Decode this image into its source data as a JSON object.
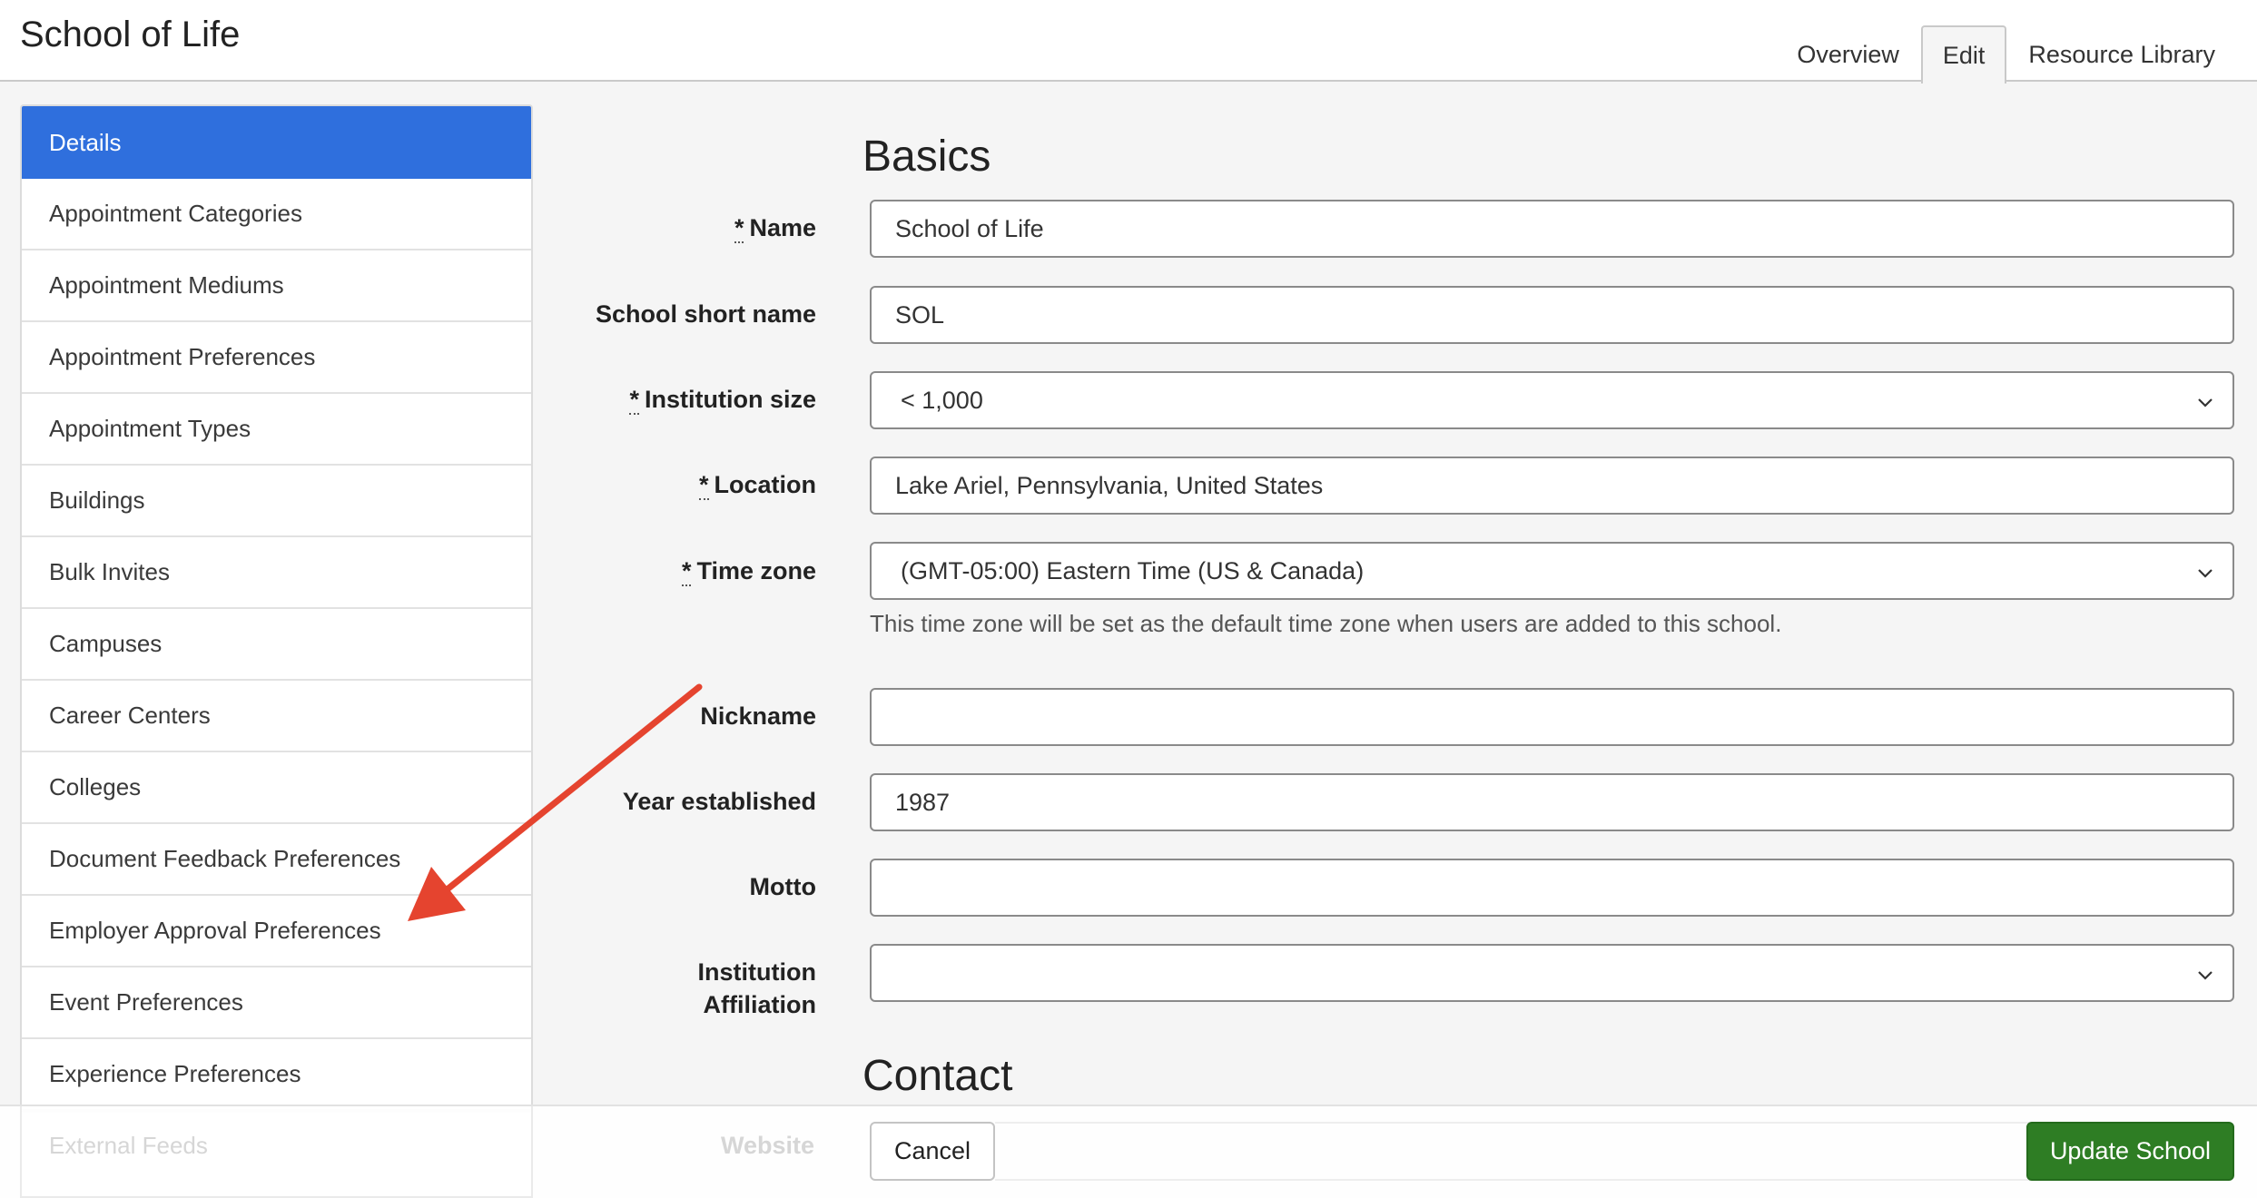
{
  "header": {
    "title": "School of Life",
    "tabs": [
      {
        "label": "Overview"
      },
      {
        "label": "Edit"
      },
      {
        "label": "Resource Library"
      }
    ]
  },
  "sidebar": {
    "items": [
      {
        "label": "Details"
      },
      {
        "label": "Appointment Categories"
      },
      {
        "label": "Appointment Mediums"
      },
      {
        "label": "Appointment Preferences"
      },
      {
        "label": "Appointment Types"
      },
      {
        "label": "Buildings"
      },
      {
        "label": "Bulk Invites"
      },
      {
        "label": "Campuses"
      },
      {
        "label": "Career Centers"
      },
      {
        "label": "Colleges"
      },
      {
        "label": "Document Feedback Preferences"
      },
      {
        "label": "Employer Approval Preferences"
      },
      {
        "label": "Event Preferences"
      },
      {
        "label": "Experience Preferences"
      },
      {
        "label": "External Feeds"
      }
    ]
  },
  "basics": {
    "title": "Basics",
    "name": {
      "label": "Name",
      "required": "*",
      "value": "School of Life"
    },
    "short_name": {
      "label": "School short name",
      "value": "SOL"
    },
    "institution_size": {
      "label": "Institution size",
      "required": "*",
      "value": "< 1,000"
    },
    "location": {
      "label": "Location",
      "required": "*",
      "value": "Lake Ariel, Pennsylvania, United States"
    },
    "time_zone": {
      "label": "Time zone",
      "required": "*",
      "value": "(GMT-05:00) Eastern Time (US & Canada)",
      "hint": "This time zone will be set as the default time zone when users are added to this school."
    },
    "nickname": {
      "label": "Nickname",
      "value": ""
    },
    "year_established": {
      "label": "Year established",
      "value": "1987"
    },
    "motto": {
      "label": "Motto",
      "value": ""
    },
    "affiliation": {
      "label_line1": "Institution",
      "label_line2": "Affiliation",
      "value": ""
    }
  },
  "contact": {
    "title": "Contact",
    "website": {
      "label": "Website"
    }
  },
  "footer": {
    "cancel_label": "Cancel",
    "update_label": "Update School"
  },
  "colors": {
    "active_sidebar": "#2f6fdd",
    "update_button": "#2e7d24",
    "annotation_arrow": "#e5442f"
  }
}
